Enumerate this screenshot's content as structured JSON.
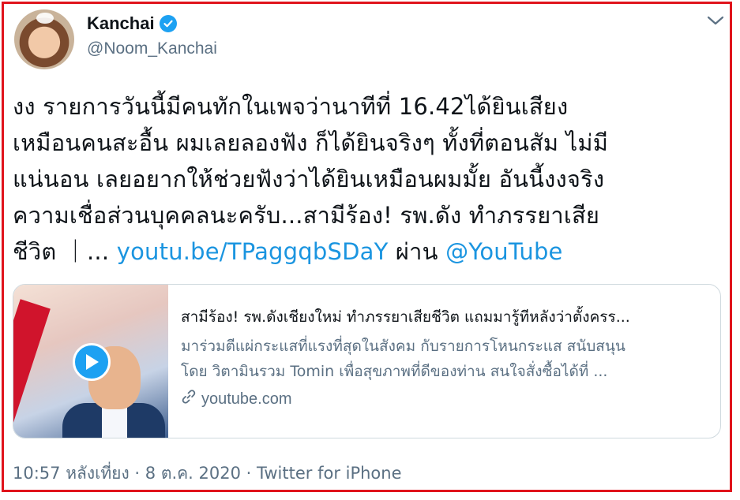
{
  "author": {
    "name": "Kanchai",
    "handle": "@Noom_Kanchai"
  },
  "tweet": {
    "line1": "งง รายการวันนี้มีคนทักในเพจว่านาทีที่ 16.42ได้ยินเสียง",
    "line2": "เหมือนคนสะอื้น ผมเลยลองฟัง ก็ได้ยินจริงๆ ทั้งที่ตอนสัม ไม่มี",
    "line3": "แน่นอน เลยอยากให้ช่วยฟังว่าได้ยินเหมือนผมมั้ย อันนี้งงจริง",
    "line4": "ความเชื่อส่วนบุคคลนะครับ...สามีร้อง! รพ.ดัง ทำภรรยาเสีย",
    "line5_prefix": "ชีวิต ｜... ",
    "link": "youtu.be/TPaggqbSDaY",
    "via": " ผ่าน ",
    "mention": "@YouTube"
  },
  "card": {
    "title": "สามีร้อง! รพ.ดังเชียงใหม่ ทำภรรยาเสียชีวิต แถมมารู้ทีหลังว่าตั้งครร...",
    "desc_line1": "มาร่วมตีแผ่กระแสที่แรงที่สุดในสังคม กับรายการโหนกระแส สนับสนุน",
    "desc_line2": "โดย วิตามินรวม Tomin เพื่อสุขภาพที่ดีของท่าน สนใจสั่งซื้อได้ที่ ...",
    "domain": "youtube.com"
  },
  "meta": {
    "time": "10:57 หลังเที่ยง",
    "sep1": " · ",
    "date": "8 ต.ค. 2020",
    "sep2": " · ",
    "source": "Twitter for iPhone"
  },
  "icons": {
    "verified": "verified-badge-icon",
    "menu": "chevron-down-icon",
    "play": "play-icon",
    "link": "link-icon"
  },
  "colors": {
    "link": "#1b95e0",
    "secondary": "#5b7083",
    "frame": "#e0141c",
    "verified": "#1da1f2"
  }
}
